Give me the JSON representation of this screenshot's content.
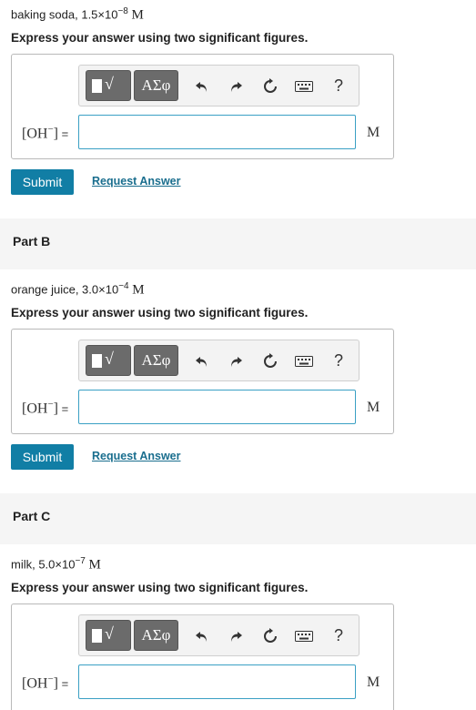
{
  "sections": [
    {
      "substance": "baking soda, 1.5×10",
      "exp": "−8",
      "unit_after": "M",
      "instruction": "Express your answer using two significant figures.",
      "label_species": "[OH",
      "label_charge": "−",
      "label_close": "]",
      "label_eq": " =",
      "input_value": "",
      "unit": "M",
      "submit": "Submit",
      "request": "Request Answer"
    },
    {
      "part_title": "Part B",
      "substance": "orange juice, 3.0×10",
      "exp": "−4",
      "unit_after": "M",
      "instruction": "Express your answer using two significant figures.",
      "label_species": "[OH",
      "label_charge": "−",
      "label_close": "]",
      "label_eq": " =",
      "input_value": "",
      "unit": "M",
      "submit": "Submit",
      "request": "Request Answer"
    },
    {
      "part_title": "Part C",
      "substance": "milk, 5.0×10",
      "exp": "−7",
      "unit_after": "M",
      "instruction": "Express your answer using two significant figures.",
      "label_species": "[OH",
      "label_charge": "−",
      "label_close": "]",
      "label_eq": " =",
      "input_value": "",
      "unit": "M"
    }
  ],
  "toolbar": {
    "templates_label": "√",
    "symbols_label": "ΑΣφ",
    "help_label": "?",
    "icons": [
      "templates-icon",
      "greek-symbols-icon",
      "undo-icon",
      "redo-icon",
      "reset-icon",
      "keyboard-icon",
      "help-icon"
    ]
  },
  "colors": {
    "accent": "#117ea5",
    "link": "#1a6e8e",
    "input_border": "#3aa0c4",
    "toolbar_button": "#6b6b6b",
    "band": "#f5f5f5"
  }
}
